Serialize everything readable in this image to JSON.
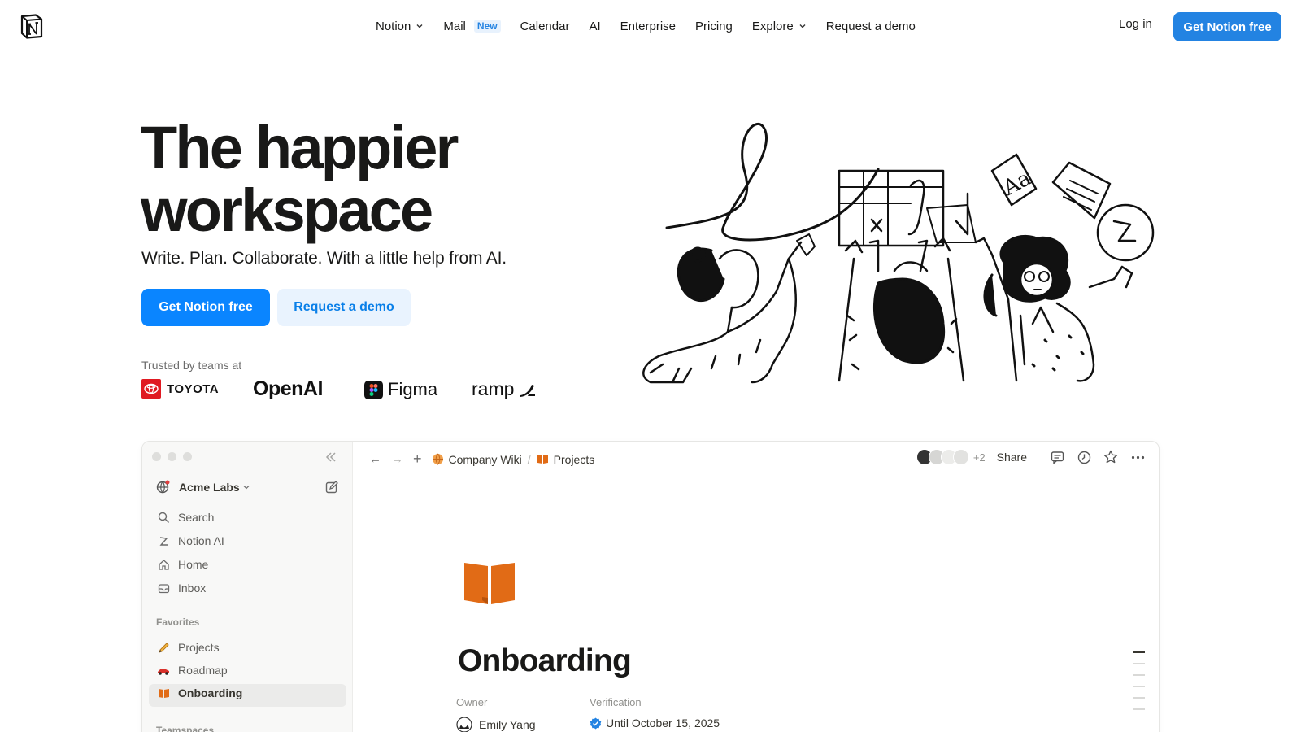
{
  "nav": {
    "items": [
      {
        "label": "Notion",
        "dropdown": true
      },
      {
        "label": "Mail",
        "badge": "New"
      },
      {
        "label": "Calendar"
      },
      {
        "label": "AI"
      },
      {
        "label": "Enterprise"
      },
      {
        "label": "Pricing"
      },
      {
        "label": "Explore",
        "dropdown": true
      },
      {
        "label": "Request a demo"
      }
    ],
    "login": "Log in",
    "cta": "Get Notion free"
  },
  "hero": {
    "title_line1": "The happier",
    "title_line2": "workspace",
    "subtitle": "Write. Plan. Collaborate. With a little help from AI.",
    "primary_button": "Get Notion free",
    "secondary_button": "Request a demo",
    "trusted_label": "Trusted by teams at",
    "logos": [
      "TOYOTA",
      "OpenAI",
      "Figma",
      "ramp"
    ]
  },
  "app": {
    "workspace": "Acme Labs",
    "sidebar": {
      "items": [
        {
          "label": "Search",
          "icon": "search-icon"
        },
        {
          "label": "Notion AI",
          "icon": "notion-ai-icon"
        },
        {
          "label": "Home",
          "icon": "home-icon"
        },
        {
          "label": "Inbox",
          "icon": "inbox-icon"
        }
      ],
      "favorites_label": "Favorites",
      "favorites": [
        {
          "label": "Projects",
          "icon": "pencil-icon"
        },
        {
          "label": "Roadmap",
          "icon": "race-car-icon"
        },
        {
          "label": "Onboarding",
          "icon": "book-icon",
          "active": true
        }
      ],
      "teamspaces_label": "Teamspaces"
    },
    "breadcrumb": [
      "Company Wiki",
      "Projects"
    ],
    "extra_collaborators": "+2",
    "share": "Share",
    "page": {
      "title": "Onboarding",
      "owner_label": "Owner",
      "owner": "Emily Yang",
      "verification_label": "Verification",
      "verification": "Until October 15, 2025"
    },
    "colors": {
      "accent": "#0a85ff",
      "book": "#e16b16"
    }
  }
}
